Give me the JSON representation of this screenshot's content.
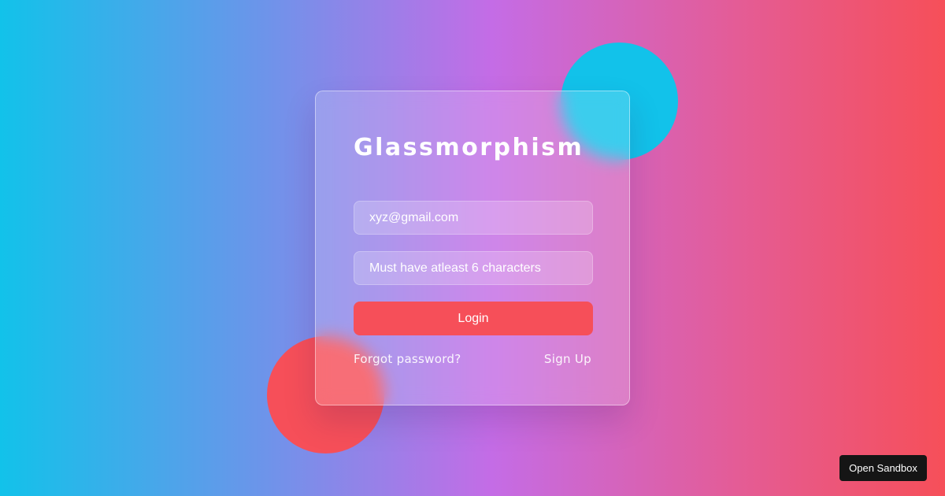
{
  "login_card": {
    "title": "Glassmorphism",
    "email": {
      "placeholder": "xyz@gmail.com"
    },
    "password": {
      "placeholder": "Must have atleast 6 characters"
    },
    "login_label": "Login",
    "forgot_password_label": "Forgot password?",
    "sign_up_label": "Sign Up"
  },
  "sandbox": {
    "label": "Open Sandbox"
  },
  "colors": {
    "gradient_start": "#12c2ea",
    "gradient_mid": "#c46ce6",
    "gradient_end": "#f64f59",
    "accent_red": "#f64f59",
    "accent_blue": "#12c2ea",
    "sandbox_bg": "#151515"
  }
}
